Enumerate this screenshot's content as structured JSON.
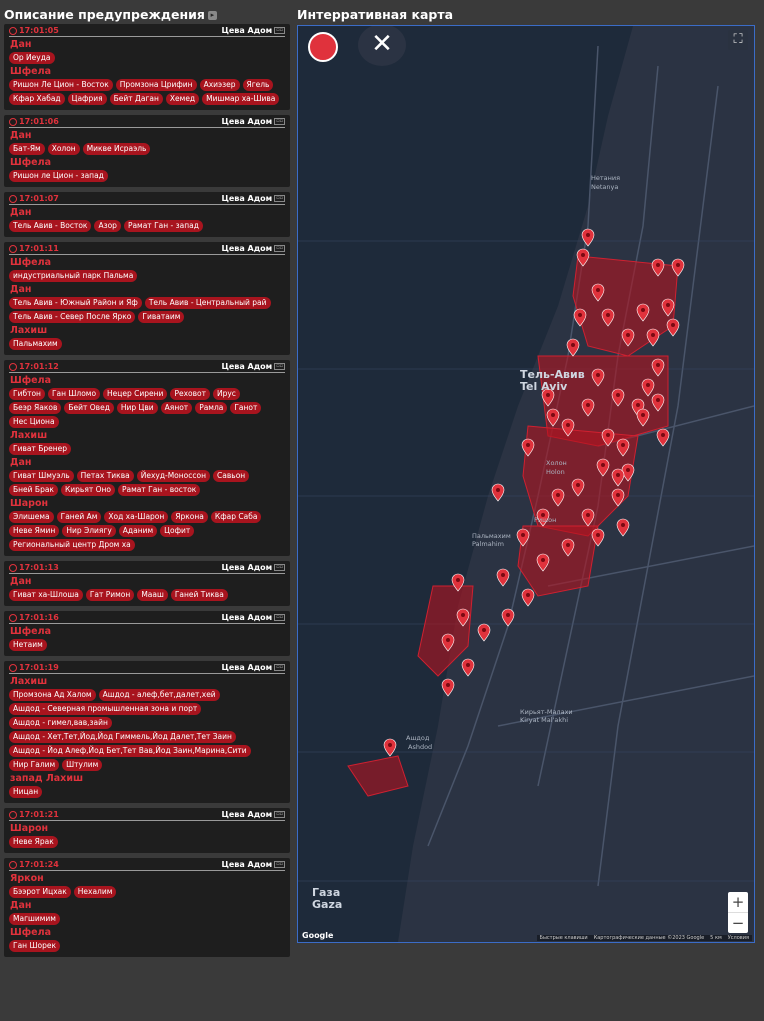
{
  "header": {
    "alerts_title": "Описание предупреждения",
    "map_title": "Интерративная карта"
  },
  "alerts": [
    {
      "time": "17:01:05",
      "source": "Цева Адом",
      "groups": [
        {
          "region": "Дан",
          "places": [
            "Ор Иеуда"
          ]
        },
        {
          "region": "Шфела",
          "places": [
            "Ришон Ле Цион - Восток",
            "Промзона Црифин",
            "Ахиэзер",
            "Ягель",
            "Кфар Хабад",
            "Цафрия",
            "Бейт Даган",
            "Хемед",
            "Мишмар ха-Шива"
          ]
        }
      ]
    },
    {
      "time": "17:01:06",
      "source": "Цева Адом",
      "groups": [
        {
          "region": "Дан",
          "places": [
            "Бат-Ям",
            "Холон",
            "Микве Исраэль"
          ]
        },
        {
          "region": "Шфела",
          "places": [
            "Ришон ле Цион - запад"
          ]
        }
      ]
    },
    {
      "time": "17:01:07",
      "source": "Цева Адом",
      "groups": [
        {
          "region": "Дан",
          "places": [
            "Тель Авив - Восток",
            "Азор",
            "Рамат Ган - запад"
          ]
        }
      ]
    },
    {
      "time": "17:01:11",
      "source": "Цева Адом",
      "groups": [
        {
          "region": "Шфела",
          "places": [
            "индустриальный парк Пальма"
          ]
        },
        {
          "region": "Дан",
          "places": [
            "Тель Авив - Южный Район и Яф",
            "Тель Авив - Центральный рай",
            "Тель Авив - Север После Ярко",
            "Гиватаим"
          ]
        },
        {
          "region": "Лахиш",
          "places": [
            "Пальмахим"
          ]
        }
      ]
    },
    {
      "time": "17:01:12",
      "source": "Цева Адом",
      "groups": [
        {
          "region": "Шфела",
          "places": [
            "Гибтон",
            "Ган Шломо",
            "Нецер Сирени",
            "Реховот",
            "Ирус",
            "Беэр Яаков",
            "Бейт Овед",
            "Нир Цви",
            "Аянот",
            "Рамла",
            "Ганот",
            "Нес Циона"
          ]
        },
        {
          "region": "Лахиш",
          "places": [
            "Гиват Бренер"
          ]
        },
        {
          "region": "Дан",
          "places": [
            "Гиват Шмуэль",
            "Петах Тиква",
            "Йехуд-Моноссон",
            "Савьон",
            "Бней Брак",
            "Кирьят Оно",
            "Рамат Ган - восток"
          ]
        },
        {
          "region": "Шарон",
          "places": [
            "Элишема",
            "Ганей Ам",
            "Ход ха-Шарон",
            "Яркона",
            "Кфар Саба",
            "Неве Ямин",
            "Нир Элиягу",
            "Аданим",
            "Цофит",
            "Региональный центр Дром ха"
          ]
        }
      ]
    },
    {
      "time": "17:01:13",
      "source": "Цева Адом",
      "groups": [
        {
          "region": "Дан",
          "places": [
            "Гиват ха-Шлоша",
            "Гат Римон",
            "Мааш",
            "Ганей Тиква"
          ]
        }
      ]
    },
    {
      "time": "17:01:16",
      "source": "Цева Адом",
      "groups": [
        {
          "region": "Шфела",
          "places": [
            "Нетаим"
          ]
        }
      ]
    },
    {
      "time": "17:01:19",
      "source": "Цева Адом",
      "groups": [
        {
          "region": "Лахиш",
          "places": [
            "Промзона Ад Халом",
            "Ашдод - алеф,бет,далет,хей",
            "Ашдод - Северная промышленная зона и порт",
            "Ашдод - гимел,вав,зайн",
            "Ашдод - Хет,Тет,Йод,Йод Гиммель,Йод Далет,Тет Заин",
            "Ашдод - Йод Алеф,Йод Бет,Тет Вав,Йод Заин,Марина,Сити",
            "Нир Галим",
            "Штулим"
          ]
        },
        {
          "region": "запад Лахиш",
          "places": [
            "Ницан"
          ]
        }
      ]
    },
    {
      "time": "17:01:21",
      "source": "Цева Адом",
      "groups": [
        {
          "region": "Шарон",
          "places": [
            "Неве Ярак"
          ]
        }
      ]
    },
    {
      "time": "17:01:24",
      "source": "Цева Адом",
      "groups": [
        {
          "region": "Яркон",
          "places": [
            "Бээрот Ицхак",
            "Нехалим"
          ]
        },
        {
          "region": "Дан",
          "places": [
            "Магшимим"
          ]
        },
        {
          "region": "Шфела",
          "places": [
            "Ган Шорек"
          ]
        }
      ]
    }
  ],
  "map": {
    "close_symbol": "✕",
    "fullscreen_symbol": "⛶",
    "zoom_in": "+",
    "zoom_out": "−",
    "google": "Google",
    "attribution": [
      "Быстрые клавиши",
      "Картографические данные ©2023 Google",
      "5 км",
      "Условия"
    ],
    "labels": [
      {
        "text": "Тель-Авив",
        "class": "big"
      },
      {
        "text": "Tel Aviv",
        "class": "big"
      },
      {
        "text": "Нетания",
        "class": ""
      },
      {
        "text": "Netanya",
        "class": ""
      },
      {
        "text": "Холон",
        "class": ""
      },
      {
        "text": "Holon",
        "class": ""
      },
      {
        "text": "Ришон",
        "class": ""
      },
      {
        "text": "Пальмахим",
        "class": ""
      },
      {
        "text": "Palmahim",
        "class": ""
      },
      {
        "text": "Ашдод",
        "class": ""
      },
      {
        "text": "Ashdod",
        "class": ""
      },
      {
        "text": "Газа",
        "class": "big"
      },
      {
        "text": "Gaza",
        "class": "big"
      },
      {
        "text": "Кирьят-Малахи",
        "class": ""
      },
      {
        "text": "Kiryat Mal'akhi",
        "class": ""
      }
    ],
    "colors": {
      "alert_zone": "#b3141f",
      "marker": "#e0323c",
      "water": "#1e2a3a",
      "land": "#2b3343"
    }
  }
}
